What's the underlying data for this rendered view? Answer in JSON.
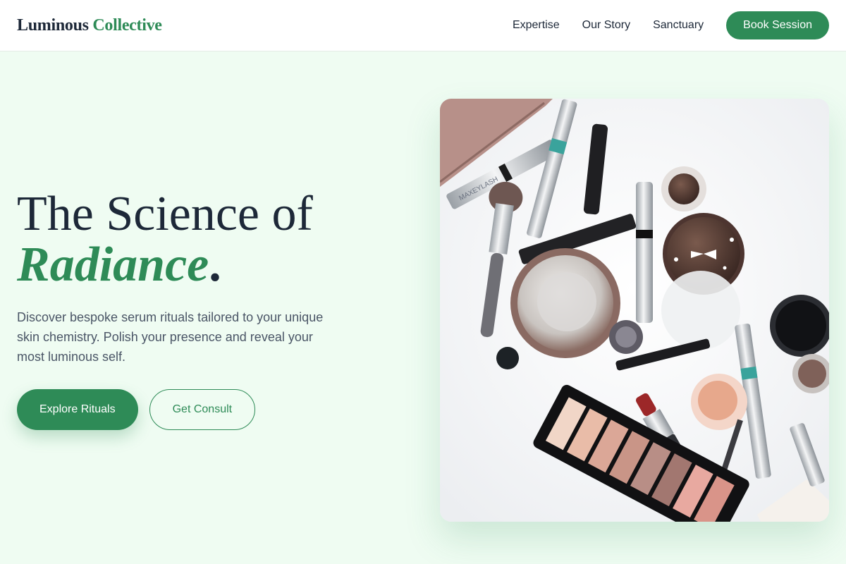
{
  "brand": {
    "name_part1": "Luminous",
    "name_part2": "Collective",
    "accent_color": "#2e8b57"
  },
  "nav": {
    "links": [
      "Expertise",
      "Our Story",
      "Sanctuary"
    ],
    "cta_label": "Book Session"
  },
  "hero": {
    "title_line1": "The Science of",
    "title_line2": "Radiance",
    "title_period": ".",
    "subtitle": "Discover bespoke serum rituals tailored to your unique skin chemistry. Polish your presence and reveal your most luminous self.",
    "primary_cta": "Explore Rituals",
    "secondary_cta": "Get Consult",
    "image_description_icon": "makeup-flatlay-image"
  },
  "colors": {
    "background": "#effcf2",
    "primary": "#2e8b57",
    "text_dark": "#1d2838",
    "text_muted": "#4a5566"
  }
}
